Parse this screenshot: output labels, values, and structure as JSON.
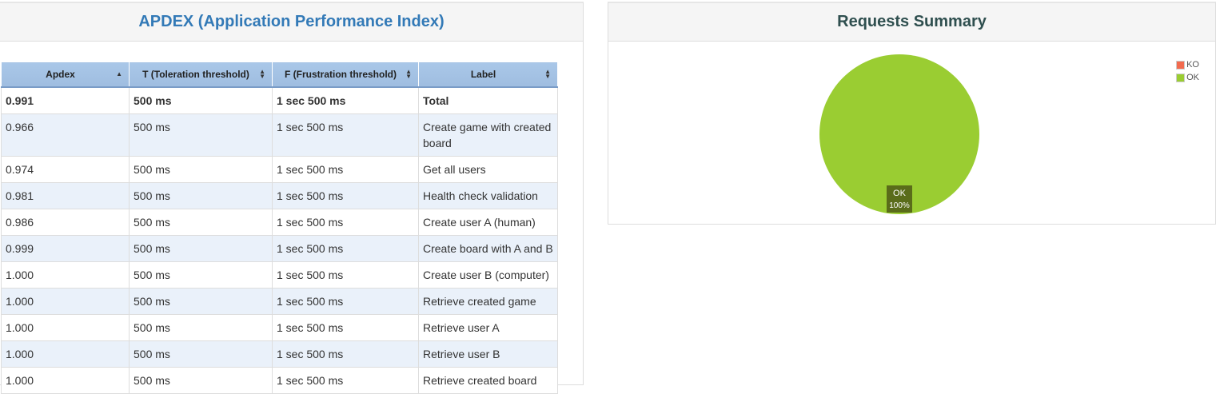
{
  "apdex": {
    "title": "APDEX (Application Performance Index)",
    "columns": [
      "Apdex",
      "T (Toleration threshold)",
      "F (Frustration threshold)",
      "Label"
    ],
    "total": [
      "0.991",
      "500 ms",
      "1 sec 500 ms",
      "Total"
    ],
    "rows": [
      [
        "0.966",
        "500 ms",
        "1 sec 500 ms",
        "Create game with created board"
      ],
      [
        "0.974",
        "500 ms",
        "1 sec 500 ms",
        "Get all users"
      ],
      [
        "0.981",
        "500 ms",
        "1 sec 500 ms",
        "Health check validation"
      ],
      [
        "0.986",
        "500 ms",
        "1 sec 500 ms",
        "Create user A (human)"
      ],
      [
        "0.999",
        "500 ms",
        "1 sec 500 ms",
        "Create board with A and B"
      ],
      [
        "1.000",
        "500 ms",
        "1 sec 500 ms",
        "Create user B (computer)"
      ],
      [
        "1.000",
        "500 ms",
        "1 sec 500 ms",
        "Retrieve created game"
      ],
      [
        "1.000",
        "500 ms",
        "1 sec 500 ms",
        "Retrieve user A"
      ],
      [
        "1.000",
        "500 ms",
        "1 sec 500 ms",
        "Retrieve user B"
      ],
      [
        "1.000",
        "500 ms",
        "1 sec 500 ms",
        "Retrieve created board"
      ]
    ],
    "sort_icons": [
      "sort-asc-icon",
      "sort-both-icon",
      "sort-both-icon",
      "sort-both-icon"
    ]
  },
  "summary": {
    "title": "Requests Summary"
  },
  "chart_data": {
    "type": "pie",
    "title": "Requests Summary",
    "categories": [
      "KO",
      "OK"
    ],
    "values": [
      0,
      100
    ],
    "colors": [
      "#f26b4f",
      "#9acd32"
    ],
    "legend_position": "top-right",
    "slice_labels": [
      {
        "name": "OK",
        "percent": "100%"
      }
    ]
  }
}
